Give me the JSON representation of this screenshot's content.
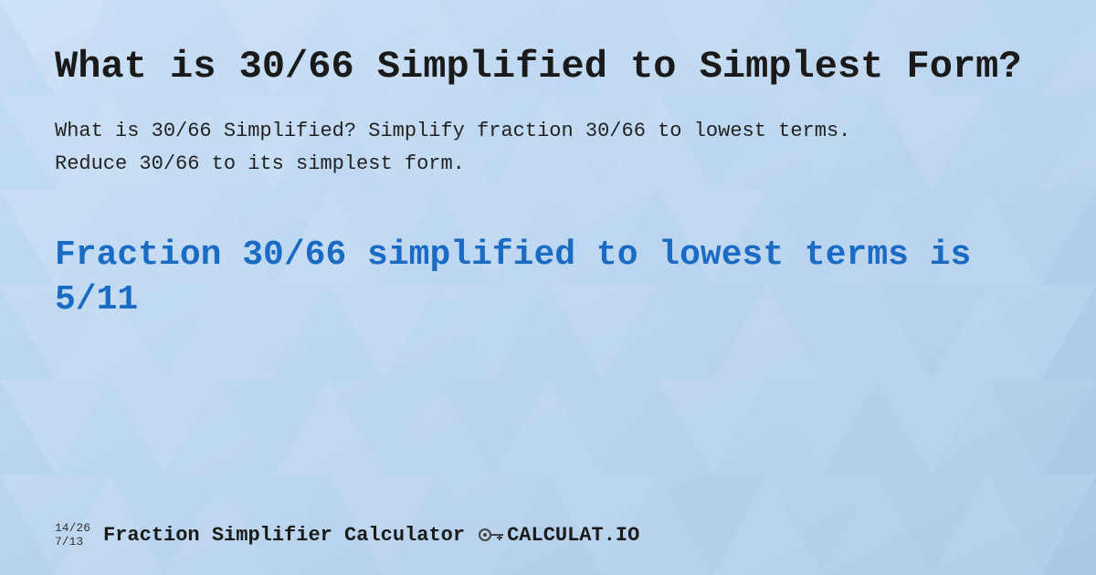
{
  "background": {
    "color": "#b8d4f0"
  },
  "header": {
    "title": "What is 30/66 Simplified to Simplest Form?"
  },
  "description": {
    "text": "What is 30/66 Simplified? Simplify fraction 30/66 to lowest terms. Reduce 30/66 to its simplest form."
  },
  "result": {
    "title": "Fraction 30/66 simplified to lowest terms is 5/11"
  },
  "footer": {
    "fraction1": "14/26",
    "fraction2": "7/13",
    "brand_name": "Fraction Simplifier Calculator",
    "logo_text": "CALCULAT.IO"
  }
}
